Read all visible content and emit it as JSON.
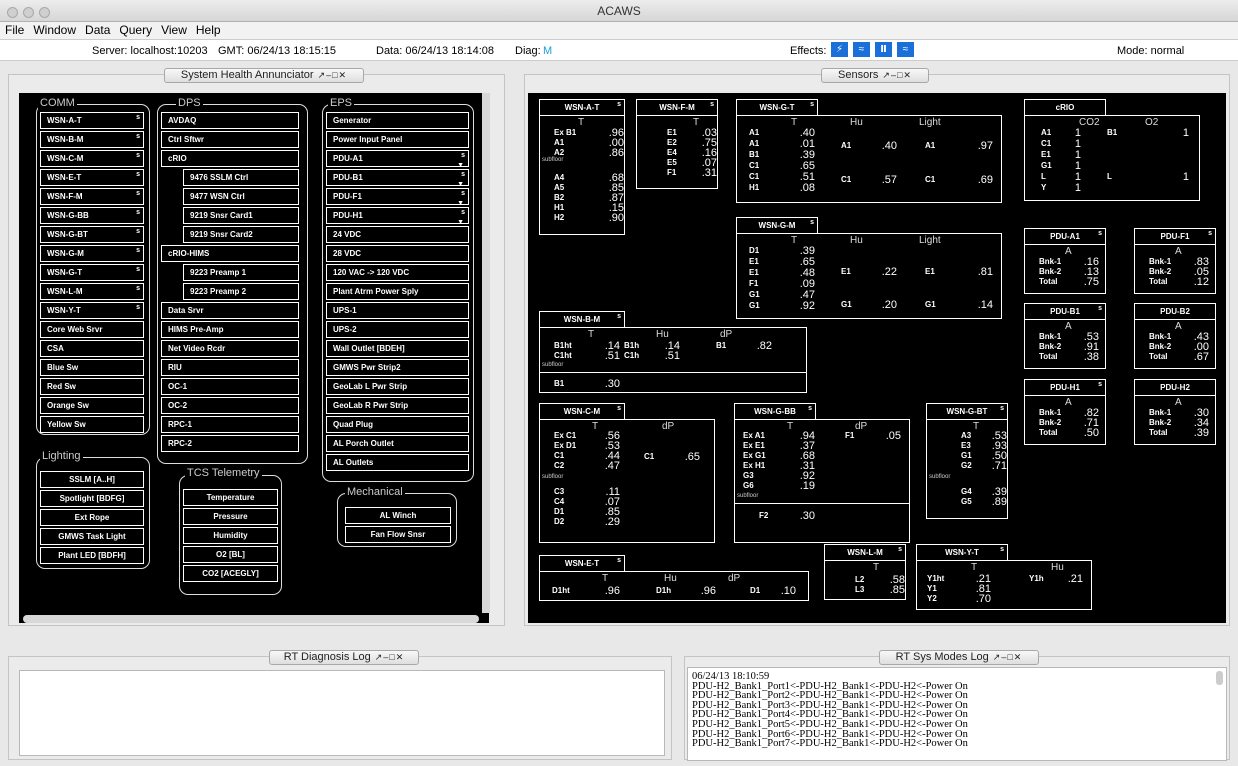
{
  "window": {
    "title": "ACAWS"
  },
  "menu": [
    "File",
    "Window",
    "Data",
    "Query",
    "View",
    "Help"
  ],
  "status": {
    "server": "Server: localhost:10203",
    "gmt": "GMT: 06/24/13 18:15:15",
    "data": "Data: 06/24/13 18:14:08",
    "diag_label": "Diag:",
    "diag_value": "M",
    "effects_label": "Effects:",
    "mode": "Mode: normal"
  },
  "panels": {
    "annunciator": "System Health Annunciator",
    "sensors": "Sensors",
    "diag_log": "RT Diagnosis Log",
    "sys_modes_log": "RT Sys Modes Log"
  },
  "annunciator": {
    "comm": {
      "label": "COMM",
      "items": [
        "WSN-A-T",
        "WSN-B-M",
        "WSN-C-M",
        "WSN-E-T",
        "WSN-F-M",
        "WSN-G-BB",
        "WSN-G-BT",
        "WSN-G-M",
        "WSN-G-T",
        "WSN-L-M",
        "WSN-Y-T",
        "Core Web Srvr",
        "CSA",
        "Blue Sw",
        "Red Sw",
        "Orange Sw",
        "Yellow Sw"
      ]
    },
    "dps": {
      "label": "DPS",
      "items": [
        "AVDAQ",
        "Ctrl Sftwr",
        "cRIO",
        "9476 SSLM Ctrl",
        "9477 WSN Ctrl",
        "9219 Snsr Card1",
        "9219 Snsr Card2",
        "cRIO-HIMS",
        "9223 Preamp 1",
        "9223 Preamp 2",
        "Data Srvr",
        "HIMS Pre-Amp",
        "Net Video Rcdr",
        "RIU",
        "OC-1",
        "OC-2",
        "RPC-1",
        "RPC-2"
      ]
    },
    "eps": {
      "label": "EPS",
      "items": [
        "Generator",
        "Power Input Panel",
        "PDU-A1",
        "PDU-B1",
        "PDU-F1",
        "PDU-H1",
        "24 VDC",
        "28 VDC",
        "120 VAC -> 120 VDC",
        "Plant Atrm Power Sply",
        "UPS-1",
        "UPS-2",
        "Wall Outlet [BDEH]",
        "GMWS Pwr Strip2",
        "GeoLab L Pwr Strip",
        "GeoLab R Pwr Strip",
        "Quad Plug",
        "AL Porch Outlet",
        "AL Outlets"
      ]
    },
    "lighting": {
      "label": "Lighting",
      "items": [
        "SSLM [A..H]",
        "Spotlight [BDFG]",
        "Ext Rope",
        "GMWS Task Light",
        "Plant LED [BDFH]"
      ]
    },
    "tcs": {
      "label": "TCS Telemetry",
      "items": [
        "Temperature",
        "Pressure",
        "Humidity",
        "O2 [BL]",
        "CO2 [ACEGLY]"
      ]
    },
    "mech": {
      "label": "Mechanical",
      "items": [
        "AL Winch",
        "Fan Flow Snsr"
      ]
    },
    "tag": "s"
  },
  "sensors": {
    "wsn_a_t": {
      "name": "WSN-A-T",
      "col": "T",
      "rows": [
        [
          "Ex B1",
          ".96"
        ],
        [
          "A1",
          ".00"
        ],
        [
          "A2",
          ".86"
        ],
        [
          "A4",
          ".68"
        ],
        [
          "A5",
          ".85"
        ],
        [
          "B2",
          ".87"
        ],
        [
          "H1",
          ".15"
        ],
        [
          "H2",
          ".90"
        ]
      ],
      "subfloor": "subfloor"
    },
    "wsn_f_m": {
      "name": "WSN-F-M",
      "col": "T",
      "rows": [
        [
          "E1",
          ".03"
        ],
        [
          "E2",
          ".75"
        ],
        [
          "E4",
          ".16"
        ],
        [
          "E5",
          ".07"
        ],
        [
          "F1",
          ".31"
        ]
      ]
    },
    "wsn_g_t": {
      "name": "WSN-G-T",
      "cols": [
        "T",
        "Hu",
        "Light"
      ],
      "rows": [
        [
          "A1",
          ".40"
        ],
        [
          "A1",
          ".01"
        ],
        [
          "B1",
          ".39"
        ],
        [
          "C1",
          ".65"
        ],
        [
          "C1",
          ".51"
        ],
        [
          "H1",
          ".08"
        ]
      ],
      "hu": [
        [
          "A1",
          ".40"
        ],
        [
          "C1",
          ".57"
        ]
      ],
      "light": [
        [
          "A1",
          ".97"
        ],
        [
          "C1",
          ".69"
        ]
      ]
    },
    "crio": {
      "name": "cRIO",
      "cols": [
        "CO2",
        "O2"
      ],
      "rows": [
        [
          "A1",
          "1"
        ],
        [
          "C1",
          "1"
        ],
        [
          "E1",
          "1"
        ],
        [
          "G1",
          "1"
        ],
        [
          "L",
          "1"
        ],
        [
          "Y",
          "1"
        ]
      ],
      "o2": [
        [
          "B1",
          "1"
        ],
        [
          "L",
          "1"
        ]
      ]
    },
    "wsn_g_m": {
      "name": "WSN-G-M",
      "cols": [
        "T",
        "Hu",
        "Light"
      ],
      "rows": [
        [
          "D1",
          ".39"
        ],
        [
          "E1",
          ".65"
        ],
        [
          "E1",
          ".48"
        ],
        [
          "F1",
          ".09"
        ],
        [
          "G1",
          ".47"
        ],
        [
          "G1",
          ".92"
        ]
      ],
      "hu": [
        [
          "E1",
          ".22"
        ],
        [
          "G1",
          ".20"
        ]
      ],
      "light": [
        [
          "E1",
          ".81"
        ],
        [
          "G1",
          ".14"
        ]
      ]
    },
    "pdu_a1": {
      "name": "PDU-A1",
      "col": "A",
      "rows": [
        [
          "Bnk-1",
          ".16"
        ],
        [
          "Bnk-2",
          ".13"
        ],
        [
          "Total",
          ".75"
        ]
      ]
    },
    "pdu_f1": {
      "name": "PDU-F1",
      "col": "A",
      "rows": [
        [
          "Bnk-1",
          ".83"
        ],
        [
          "Bnk-2",
          ".05"
        ],
        [
          "Total",
          ".12"
        ]
      ]
    },
    "pdu_b1": {
      "name": "PDU-B1",
      "col": "A",
      "rows": [
        [
          "Bnk-1",
          ".53"
        ],
        [
          "Bnk-2",
          ".91"
        ],
        [
          "Total",
          ".38"
        ]
      ]
    },
    "pdu_b2": {
      "name": "PDU-B2",
      "col": "A",
      "rows": [
        [
          "Bnk-1",
          ".43"
        ],
        [
          "Bnk-2",
          ".00"
        ],
        [
          "Total",
          ".67"
        ]
      ]
    },
    "pdu_h1": {
      "name": "PDU-H1",
      "col": "A",
      "rows": [
        [
          "Bnk-1",
          ".82"
        ],
        [
          "Bnk-2",
          ".71"
        ],
        [
          "Total",
          ".50"
        ]
      ]
    },
    "pdu_h2": {
      "name": "PDU-H2",
      "col": "A",
      "rows": [
        [
          "Bnk-1",
          ".30"
        ],
        [
          "Bnk-2",
          ".34"
        ],
        [
          "Total",
          ".39"
        ]
      ]
    },
    "wsn_b_m": {
      "name": "WSN-B-M",
      "cols": [
        "T",
        "Hu",
        "dP"
      ],
      "t": [
        [
          "B1ht",
          ".14"
        ],
        [
          "C1ht",
          ".51"
        ]
      ],
      "hu": [
        [
          "B1h",
          ".14"
        ],
        [
          "C1h",
          ".51"
        ]
      ],
      "dp": [
        [
          "B1",
          ".82"
        ]
      ],
      "subfloor": "subfloor",
      "sub": [
        [
          "B1",
          ".30"
        ]
      ]
    },
    "wsn_c_m": {
      "name": "WSN-C-M",
      "cols": [
        "T",
        "dP"
      ],
      "t": [
        [
          "Ex C1",
          ".56"
        ],
        [
          "Ex D1",
          ".53"
        ],
        [
          "C1",
          ".44"
        ],
        [
          "C2",
          ".47"
        ]
      ],
      "dp": [
        [
          "C1",
          ".65"
        ]
      ],
      "subfloor": "subfloor",
      "sub": [
        [
          "C3",
          ".11"
        ],
        [
          "C4",
          ".07"
        ],
        [
          "D1",
          ".85"
        ],
        [
          "D2",
          ".29"
        ]
      ]
    },
    "wsn_g_bb": {
      "name": "WSN-G-BB",
      "cols": [
        "T",
        "dP"
      ],
      "t": [
        [
          "Ex A1",
          ".94"
        ],
        [
          "Ex E1",
          ".37"
        ],
        [
          "Ex G1",
          ".68"
        ],
        [
          "Ex H1",
          ".31"
        ],
        [
          "G3",
          ".92"
        ],
        [
          "G6",
          ".19"
        ]
      ],
      "dp": [
        [
          "F1",
          ".05"
        ]
      ],
      "subfloor": "subfloor",
      "sub": [
        [
          "F2",
          ".30"
        ]
      ]
    },
    "wsn_g_bt": {
      "name": "WSN-G-BT",
      "col": "T",
      "t": [
        [
          "A3",
          ".53"
        ],
        [
          "E3",
          ".93"
        ],
        [
          "G1",
          ".50"
        ],
        [
          "G2",
          ".71"
        ]
      ],
      "subfloor": "subfloor",
      "sub": [
        [
          "G4",
          ".39"
        ],
        [
          "G5",
          ".89"
        ]
      ]
    },
    "wsn_e_t": {
      "name": "WSN-E-T",
      "cols": [
        "T",
        "Hu",
        "dP"
      ],
      "t": [
        [
          "D1ht",
          ".96"
        ]
      ],
      "hu": [
        [
          "D1h",
          ".96"
        ]
      ],
      "dp": [
        [
          "D1",
          ".10"
        ]
      ]
    },
    "wsn_l_m": {
      "name": "WSN-L-M",
      "col": "T",
      "t": [
        [
          "L2",
          ".58"
        ],
        [
          "L3",
          ".85"
        ]
      ]
    },
    "wsn_y_t": {
      "name": "WSN-Y-T",
      "cols": [
        "T",
        "Hu"
      ],
      "t": [
        [
          "Y1ht",
          ".21"
        ],
        [
          "Y1",
          ".81"
        ],
        [
          "Y2",
          ".70"
        ]
      ],
      "hu": [
        [
          "Y1h",
          ".21"
        ]
      ]
    },
    "tag": "s"
  },
  "sys_modes_log": {
    "lines": [
      "06/24/13 18:10:59",
      "PDU-H2_Bank1_Port1<-PDU-H2_Bank1<-PDU-H2<-Power On",
      "PDU-H2_Bank1_Port2<-PDU-H2_Bank1<-PDU-H2<-Power On",
      "PDU-H2_Bank1_Port3<-PDU-H2_Bank1<-PDU-H2<-Power On",
      "PDU-H2_Bank1_Port4<-PDU-H2_Bank1<-PDU-H2<-Power On",
      "PDU-H2_Bank1_Port5<-PDU-H2_Bank1<-PDU-H2<-Power On",
      "PDU-H2_Bank1_Port6<-PDU-H2_Bank1<-PDU-H2<-Power On",
      "PDU-H2_Bank1_Port7<-PDU-H2_Bank1<-PDU-H2<-Power On"
    ]
  },
  "colors": {
    "diag": "#1aa0e0",
    "effects": "#1a6fd9",
    "canvas": "#000000"
  }
}
